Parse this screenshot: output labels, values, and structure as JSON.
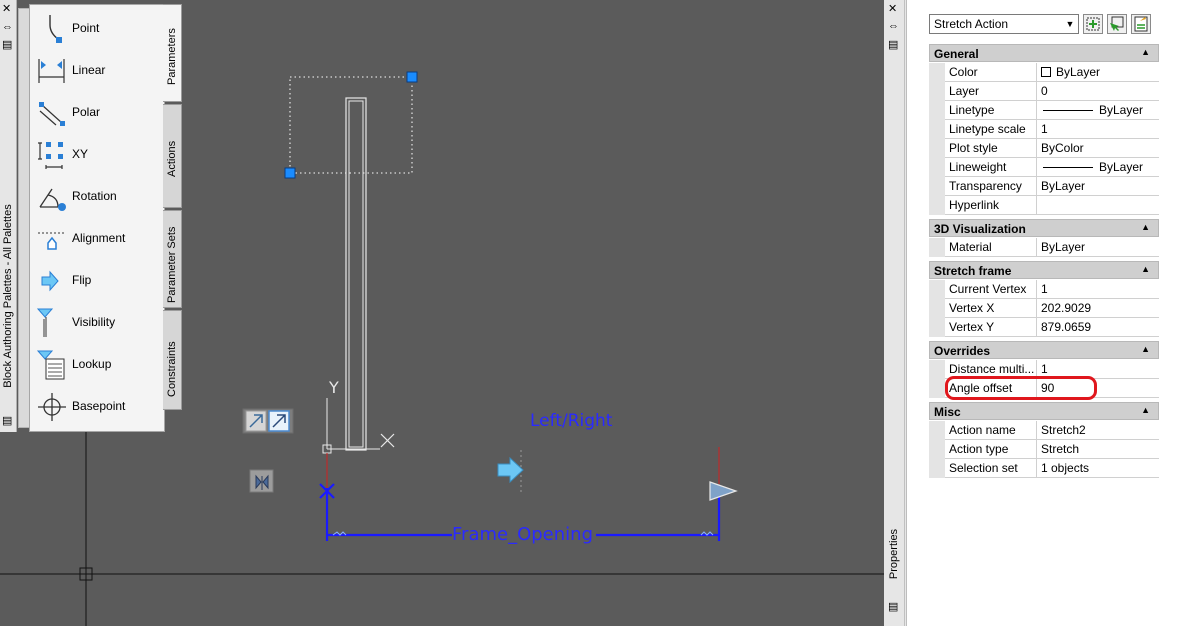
{
  "palette": {
    "title": "Block Authoring Palettes - All Palettes",
    "tabs": [
      "Parameters",
      "Actions",
      "Parameter Sets",
      "Constraints"
    ],
    "items": [
      {
        "label": "Point",
        "icon": "point-param-icon"
      },
      {
        "label": "Linear",
        "icon": "linear-param-icon"
      },
      {
        "label": "Polar",
        "icon": "polar-param-icon"
      },
      {
        "label": "XY",
        "icon": "xy-param-icon"
      },
      {
        "label": "Rotation",
        "icon": "rotation-param-icon"
      },
      {
        "label": "Alignment",
        "icon": "alignment-param-icon"
      },
      {
        "label": "Flip",
        "icon": "flip-param-icon"
      },
      {
        "label": "Visibility",
        "icon": "visibility-param-icon"
      },
      {
        "label": "Lookup",
        "icon": "lookup-param-icon"
      },
      {
        "label": "Basepoint",
        "icon": "basepoint-param-icon"
      }
    ]
  },
  "drawing": {
    "flip_label": "Left/Right",
    "dim_label": "Frame_Opening",
    "ucs_y": "Y"
  },
  "properties": {
    "title": "Properties",
    "selected": "Stretch Action",
    "groups": [
      {
        "name": "General",
        "rows": [
          {
            "name": "Color",
            "value": "ByLayer"
          },
          {
            "name": "Layer",
            "value": "0"
          },
          {
            "name": "Linetype",
            "value": "ByLayer"
          },
          {
            "name": "Linetype scale",
            "value": "1"
          },
          {
            "name": "Plot style",
            "value": "ByColor"
          },
          {
            "name": "Lineweight",
            "value": "ByLayer"
          },
          {
            "name": "Transparency",
            "value": "ByLayer"
          },
          {
            "name": "Hyperlink",
            "value": ""
          }
        ]
      },
      {
        "name": "3D Visualization",
        "rows": [
          {
            "name": "Material",
            "value": "ByLayer"
          }
        ]
      },
      {
        "name": "Stretch frame",
        "rows": [
          {
            "name": "Current Vertex",
            "value": "1"
          },
          {
            "name": "Vertex X",
            "value": "202.9029"
          },
          {
            "name": "Vertex Y",
            "value": "879.0659"
          }
        ]
      },
      {
        "name": "Overrides",
        "rows": [
          {
            "name": "Distance multi...",
            "value": "1"
          },
          {
            "name": "Angle offset",
            "value": "90"
          }
        ]
      },
      {
        "name": "Misc",
        "rows": [
          {
            "name": "Action name",
            "value": "Stretch2"
          },
          {
            "name": "Action type",
            "value": "Stretch"
          },
          {
            "name": "Selection set",
            "value": "1 objects"
          }
        ]
      }
    ]
  },
  "colors": {
    "canvas": "#5b5b5b",
    "dim_blue": "#1a1aff",
    "grip_blue": "#1a8cff",
    "highlight_red": "#e0171d"
  }
}
